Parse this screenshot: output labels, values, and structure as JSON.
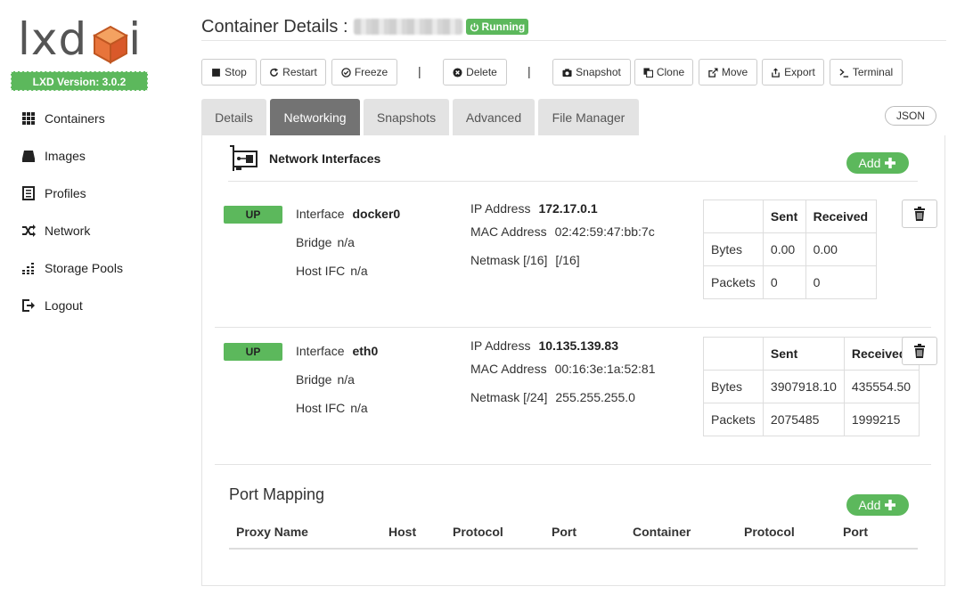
{
  "sidebar": {
    "logo_text": "lxd ui",
    "version": "LXD Version: 3.0.2",
    "items": [
      {
        "label": "Containers",
        "icon": "grid-icon"
      },
      {
        "label": "Images",
        "icon": "hard-drive-icon"
      },
      {
        "label": "Profiles",
        "icon": "list-icon"
      },
      {
        "label": "Network",
        "icon": "shuffle-icon"
      },
      {
        "label": "Storage Pools",
        "icon": "bars-icon"
      },
      {
        "label": "Logout",
        "icon": "sign-out-icon"
      }
    ]
  },
  "header": {
    "title": "Container Details :",
    "status": "Running"
  },
  "toolbar": {
    "stop": "Stop",
    "restart": "Restart",
    "freeze": "Freeze",
    "delete": "Delete",
    "snapshot": "Snapshot",
    "clone": "Clone",
    "move": "Move",
    "export": "Export",
    "terminal": "Terminal",
    "separator": "|"
  },
  "tabs": [
    "Details",
    "Networking",
    "Snapshots",
    "Advanced",
    "File Manager"
  ],
  "active_tab": "Networking",
  "json_button": "JSON",
  "network": {
    "section_title": "Network Interfaces",
    "add_label": "Add",
    "interfaces": [
      {
        "state": "UP",
        "interface_label": "Interface",
        "interface": "docker0",
        "bridge_label": "Bridge",
        "bridge": "n/a",
        "host_ifc_label": "Host IFC",
        "host_ifc": "n/a",
        "ip_label": "IP Address",
        "ip": "172.17.0.1",
        "mac_label": "MAC Address",
        "mac": "02:42:59:47:bb:7c",
        "netmask_label": "Netmask [/16]",
        "netmask": "[/16]",
        "stats_headers": [
          "",
          "Sent",
          "Received"
        ],
        "bytes_label": "Bytes",
        "bytes_sent": "0.00",
        "bytes_received": "0.00",
        "packets_label": "Packets",
        "packets_sent": "0",
        "packets_received": "0"
      },
      {
        "state": "UP",
        "interface_label": "Interface",
        "interface": "eth0",
        "bridge_label": "Bridge",
        "bridge": "n/a",
        "host_ifc_label": "Host IFC",
        "host_ifc": "n/a",
        "ip_label": "IP Address",
        "ip": "10.135.139.83",
        "mac_label": "MAC Address",
        "mac": "00:16:3e:1a:52:81",
        "netmask_label": "Netmask [/24]",
        "netmask": "255.255.255.0",
        "stats_headers": [
          "",
          "Sent",
          "Received"
        ],
        "bytes_label": "Bytes",
        "bytes_sent": "3907918.10",
        "bytes_received": "435554.50",
        "packets_label": "Packets",
        "packets_sent": "2075485",
        "packets_received": "1999215"
      }
    ]
  },
  "port_mapping": {
    "title": "Port Mapping",
    "add_label": "Add",
    "columns": [
      "Proxy Name",
      "Host",
      "Protocol",
      "Port",
      "Container",
      "Protocol",
      "Port"
    ]
  },
  "colors": {
    "accent_green": "#5cb85c",
    "active_tab": "#737373",
    "inactive_tab": "#e3e3e3",
    "logo_orange": "#e8743b"
  }
}
